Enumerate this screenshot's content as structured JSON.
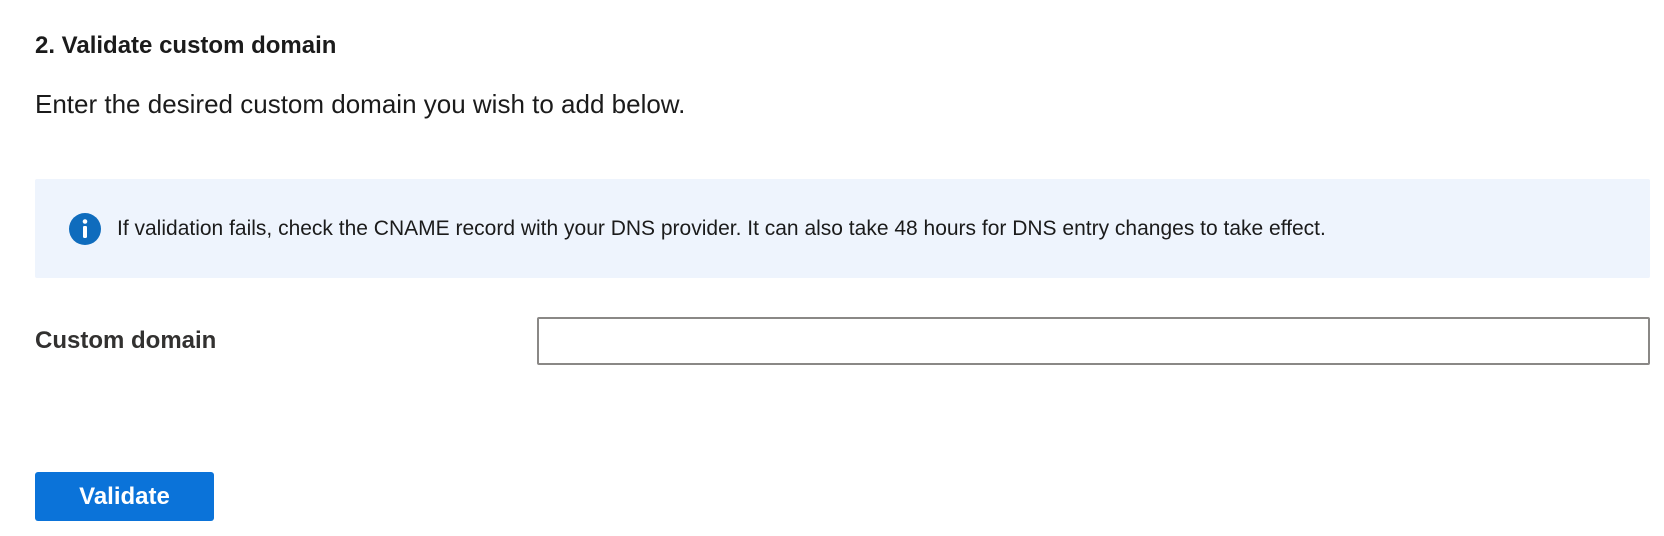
{
  "section": {
    "title": "2. Validate custom domain",
    "description": "Enter the desired custom domain you wish to add below."
  },
  "info_banner": {
    "icon": "info-icon",
    "icon_color": "#0f6cbd",
    "background_color": "#eef4fd",
    "text": "If validation fails, check the CNAME record with your DNS provider. It can also take 48 hours for DNS entry changes to take effect."
  },
  "custom_domain_field": {
    "label": "Custom domain",
    "value": "",
    "placeholder": ""
  },
  "actions": {
    "validate_label": "Validate",
    "primary_color": "#0b73d9"
  }
}
